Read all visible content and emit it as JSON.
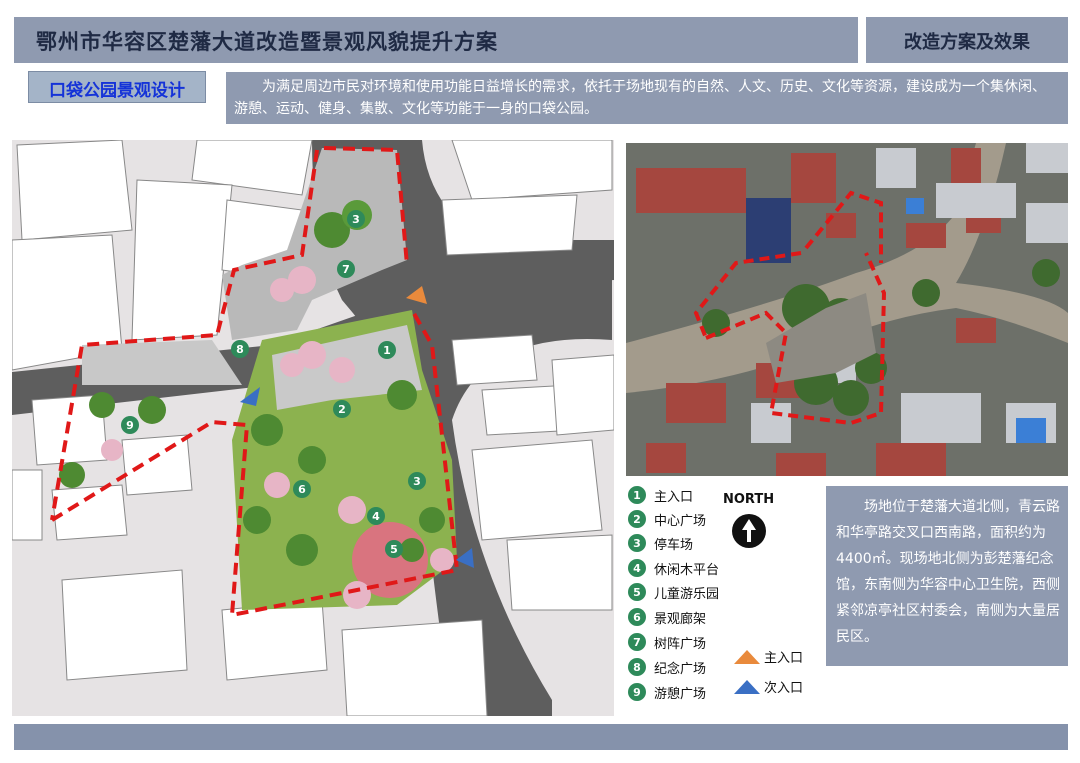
{
  "header": {
    "title": "鄂州市华容区楚藩大道改造暨景观风貌提升方案",
    "section": "改造方案及效果"
  },
  "subsection": {
    "tag": "口袋公园景观设计",
    "intro": "为满足周边市民对环境和使用功能日益增长的需求，依托于场地现有的自然、人文、历史、文化等资源，建设成为一个集休闲、游憩、运动、健身、集散、文化等功能于一身的口袋公园。"
  },
  "plan": {
    "markers": [
      "1",
      "2",
      "3",
      "3",
      "4",
      "5",
      "6",
      "7",
      "8",
      "9"
    ]
  },
  "legend": {
    "items": [
      {
        "num": "1",
        "label": "主入口"
      },
      {
        "num": "2",
        "label": "中心广场"
      },
      {
        "num": "3",
        "label": "停车场"
      },
      {
        "num": "4",
        "label": "休闲木平台"
      },
      {
        "num": "5",
        "label": "儿童游乐园"
      },
      {
        "num": "6",
        "label": "景观廊架"
      },
      {
        "num": "7",
        "label": "树阵广场"
      },
      {
        "num": "8",
        "label": "纪念广场"
      },
      {
        "num": "9",
        "label": "游憩广场"
      }
    ],
    "main_entrance": "主入口",
    "secondary_entrance": "次入口",
    "north": "NORTH",
    "colors": {
      "main_entrance": "#e98a3c",
      "secondary_entrance": "#3a6fc4",
      "marker": "#2e8a5a",
      "boundary": "#e01818"
    }
  },
  "description": "场地位于楚藩大道北侧，青云路和华亭路交叉口西南路，面积约为4400㎡。现场地北侧为彭楚藩纪念馆，东南侧为华容中心卫生院，西侧紧邻凉亭社区村委会，南侧为大量居民区。"
}
